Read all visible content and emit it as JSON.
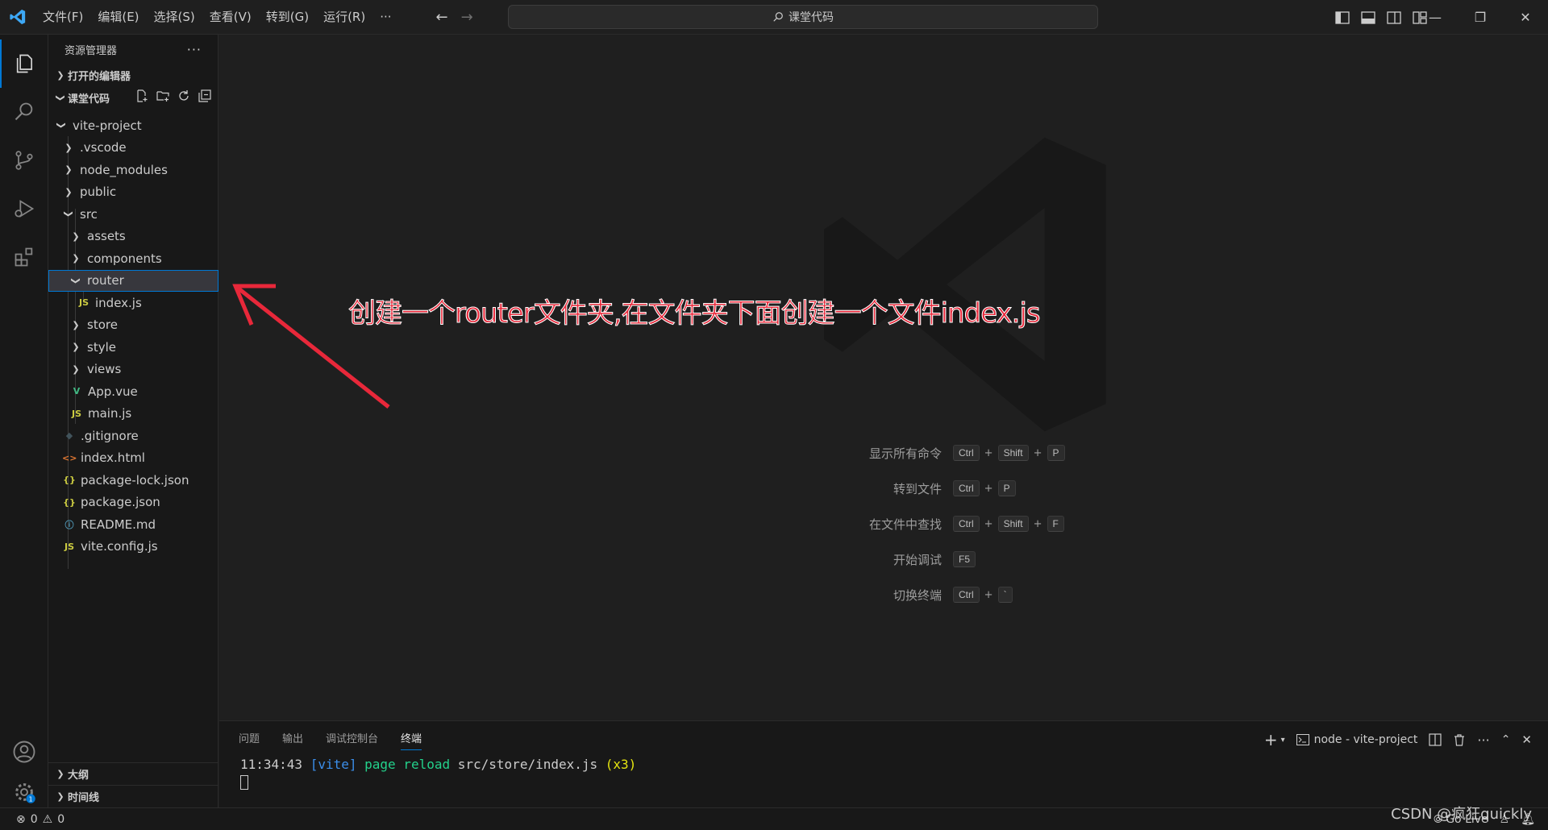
{
  "titlebar": {
    "menu": [
      "文件(F)",
      "编辑(E)",
      "选择(S)",
      "查看(V)",
      "转到(G)",
      "运行(R)",
      "···"
    ],
    "search_text": "课堂代码"
  },
  "sidebar": {
    "title": "资源管理器",
    "open_editors": "打开的编辑器",
    "workspace": "课堂代码",
    "tree": [
      {
        "label": "vite-project",
        "kind": "folder-open",
        "depth": 0
      },
      {
        "label": ".vscode",
        "kind": "folder",
        "depth": 1
      },
      {
        "label": "node_modules",
        "kind": "folder",
        "depth": 1
      },
      {
        "label": "public",
        "kind": "folder",
        "depth": 1
      },
      {
        "label": "src",
        "kind": "folder-open",
        "depth": 1
      },
      {
        "label": "assets",
        "kind": "folder",
        "depth": 2
      },
      {
        "label": "components",
        "kind": "folder",
        "depth": 2
      },
      {
        "label": "router",
        "kind": "folder-open",
        "depth": 2,
        "selected": true
      },
      {
        "label": "index.js",
        "kind": "js",
        "depth": 3
      },
      {
        "label": "store",
        "kind": "folder",
        "depth": 2
      },
      {
        "label": "style",
        "kind": "folder",
        "depth": 2
      },
      {
        "label": "views",
        "kind": "folder",
        "depth": 2
      },
      {
        "label": "App.vue",
        "kind": "vue",
        "depth": 2
      },
      {
        "label": "main.js",
        "kind": "js",
        "depth": 2
      },
      {
        "label": ".gitignore",
        "kind": "git",
        "depth": 1
      },
      {
        "label": "index.html",
        "kind": "html",
        "depth": 1
      },
      {
        "label": "package-lock.json",
        "kind": "json",
        "depth": 1
      },
      {
        "label": "package.json",
        "kind": "json",
        "depth": 1
      },
      {
        "label": "README.md",
        "kind": "info",
        "depth": 1
      },
      {
        "label": "vite.config.js",
        "kind": "js",
        "depth": 1
      }
    ],
    "outline": "大纲",
    "timeline": "时间线"
  },
  "editor": {
    "annotation": "创建一个router文件夹,在文件夹下面创建一个文件index.js",
    "shortcuts": [
      {
        "label": "显示所有命令",
        "keys": [
          "Ctrl",
          "Shift",
          "P"
        ]
      },
      {
        "label": "转到文件",
        "keys": [
          "Ctrl",
          "P"
        ]
      },
      {
        "label": "在文件中查找",
        "keys": [
          "Ctrl",
          "Shift",
          "F"
        ]
      },
      {
        "label": "开始调试",
        "keys": [
          "F5"
        ]
      },
      {
        "label": "切换终端",
        "keys": [
          "Ctrl",
          "`"
        ]
      }
    ]
  },
  "panel": {
    "tabs": [
      "问题",
      "输出",
      "调试控制台",
      "终端"
    ],
    "active_tab": "终端",
    "terminal_name": "node - vite-project",
    "terminal_line": {
      "time": "11:34:43",
      "tag": "[vite]",
      "action": "page reload",
      "path": "src/store/index.js",
      "count": "(x3)"
    }
  },
  "statusbar": {
    "errors": "0",
    "warnings": "0",
    "golive": "Go Live"
  },
  "watermark_text": "CSDN @疯狂quickly",
  "colors": {
    "accent": "#0078d4",
    "annotation": "#e8283a",
    "js": "#cbcb41",
    "vue": "#41b883",
    "html": "#e37933",
    "json": "#cbcb41",
    "info": "#519aba",
    "git": "#41535b"
  }
}
